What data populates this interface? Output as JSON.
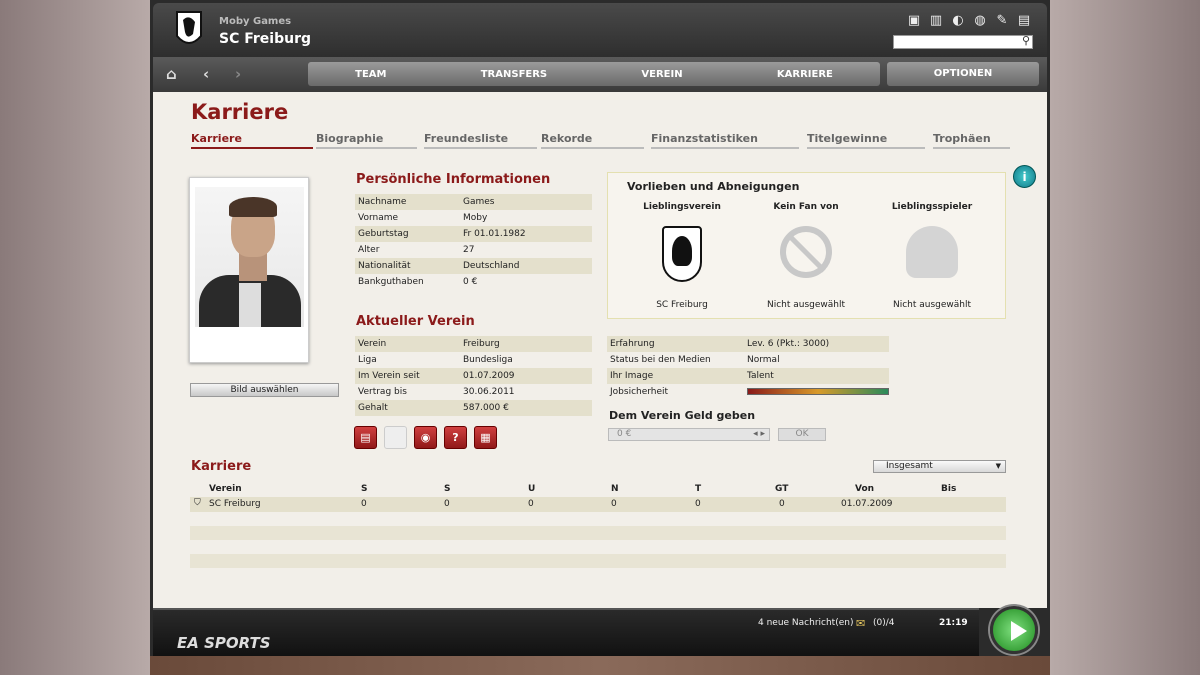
{
  "header": {
    "subtitle": "Moby Games",
    "title": "SC Freiburg",
    "icons": [
      "screen-icon",
      "stats-icon",
      "refresh-icon",
      "globe-icon",
      "tools-icon",
      "notes-icon"
    ],
    "search_placeholder": ""
  },
  "nav": {
    "tabs": [
      "TEAM",
      "TRANSFERS",
      "VEREIN",
      "KARRIERE"
    ],
    "options": "OPTIONEN"
  },
  "page": {
    "title": "Karriere",
    "subtabs": [
      "Karriere",
      "Biographie",
      "Freundesliste",
      "Rekorde",
      "Finanzstatistiken",
      "Titelgewinne",
      "Trophäen"
    ]
  },
  "photo": {
    "button": "Bild auswählen"
  },
  "personal": {
    "title": "Persönliche Informationen",
    "rows": [
      {
        "k": "Nachname",
        "v": "Games"
      },
      {
        "k": "Vorname",
        "v": "Moby"
      },
      {
        "k": "Geburtstag",
        "v": "Fr 01.01.1982"
      },
      {
        "k": "Alter",
        "v": "27"
      },
      {
        "k": "Nationalität",
        "v": "Deutschland"
      },
      {
        "k": "Bankguthaben",
        "v": "0 €"
      }
    ]
  },
  "verein": {
    "title": "Aktueller Verein",
    "rows": [
      {
        "k": "Verein",
        "v": "Freiburg"
      },
      {
        "k": "Liga",
        "v": "Bundesliga"
      },
      {
        "k": "Im Verein seit",
        "v": "01.07.2009"
      },
      {
        "k": "Vertrag bis",
        "v": "30.06.2011"
      },
      {
        "k": "Gehalt",
        "v": "587.000 €"
      }
    ]
  },
  "vorlieben": {
    "title": "Vorlieben und Abneigungen",
    "cols": [
      {
        "h": "Lieblingsverein",
        "f": "SC Freiburg"
      },
      {
        "h": "Kein Fan von",
        "f": "Nicht ausgewählt"
      },
      {
        "h": "Lieblingsspieler",
        "f": "Nicht ausgewählt"
      }
    ]
  },
  "stats": {
    "rows": [
      {
        "k": "Erfahrung",
        "v": "Lev. 6 (Pkt.: 3000)"
      },
      {
        "k": "Status bei den Medien",
        "v": "Normal"
      },
      {
        "k": "Ihr Image",
        "v": "Talent"
      },
      {
        "k": "Jobsicherheit",
        "v": ""
      }
    ],
    "jobsicherheit": 1.0
  },
  "geld": {
    "title": "Dem Verein Geld geben",
    "value": "0 €",
    "ok": "OK"
  },
  "karriere": {
    "title": "Karriere",
    "filter": "Insgesamt",
    "headers": [
      "Verein",
      "S",
      "S",
      "U",
      "N",
      "T",
      "GT",
      "Von",
      "Bis"
    ],
    "rows": [
      [
        "SC Freiburg",
        "0",
        "0",
        "0",
        "0",
        "0",
        "0",
        "01.07.2009",
        ""
      ]
    ]
  },
  "footer": {
    "brand": "EA SPORTS",
    "messages": "4 neue Nachricht(en)",
    "msgcount": "(0)/4",
    "time": "21:19"
  },
  "colors": {
    "accent": "#8b1a1a",
    "row": "#e4e0cc"
  }
}
